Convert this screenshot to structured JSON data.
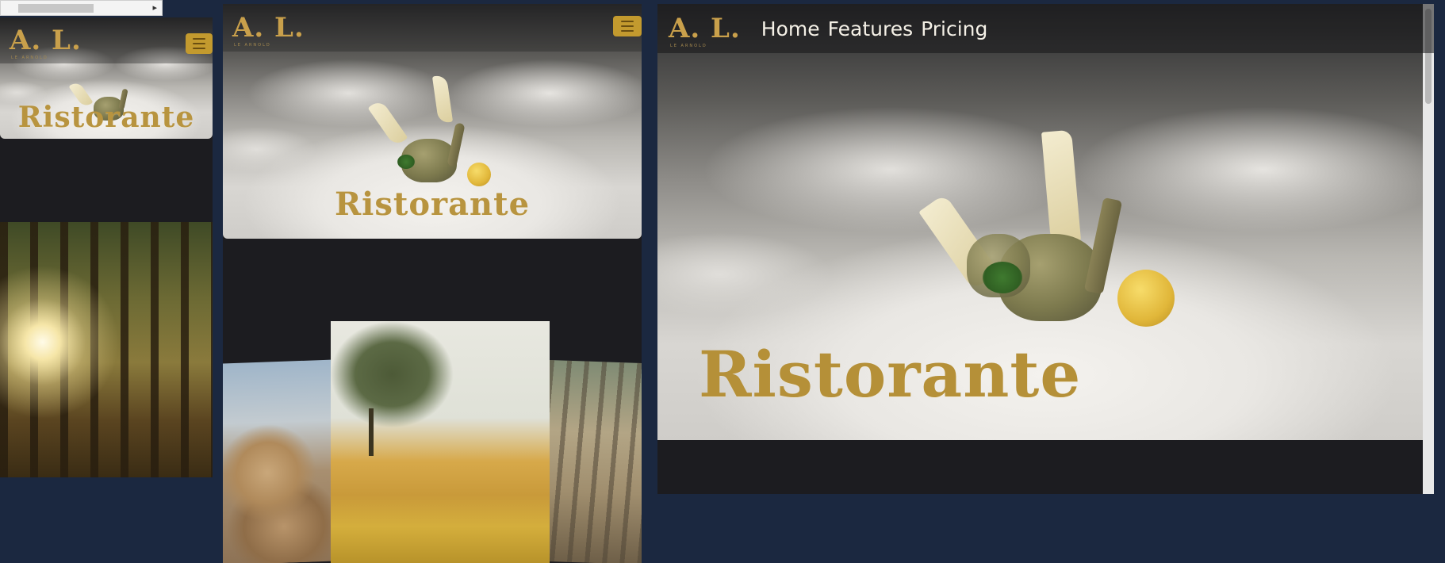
{
  "brand": {
    "logo": "A. L.",
    "logo_sub": "LE ARNOLD"
  },
  "hero": {
    "title": "Ristorante"
  },
  "nav": {
    "links": [
      "Home",
      "Features",
      "Pricing"
    ]
  },
  "icons": {
    "menu": "hamburger-menu-icon",
    "scroll_right": "chevron-right-icon"
  },
  "colors": {
    "gold": "#c9a04b",
    "background": "#1b2840",
    "panel": "#1c1c20",
    "menu_button": "#c39a2e"
  },
  "scrollbar_arrow": "▸"
}
